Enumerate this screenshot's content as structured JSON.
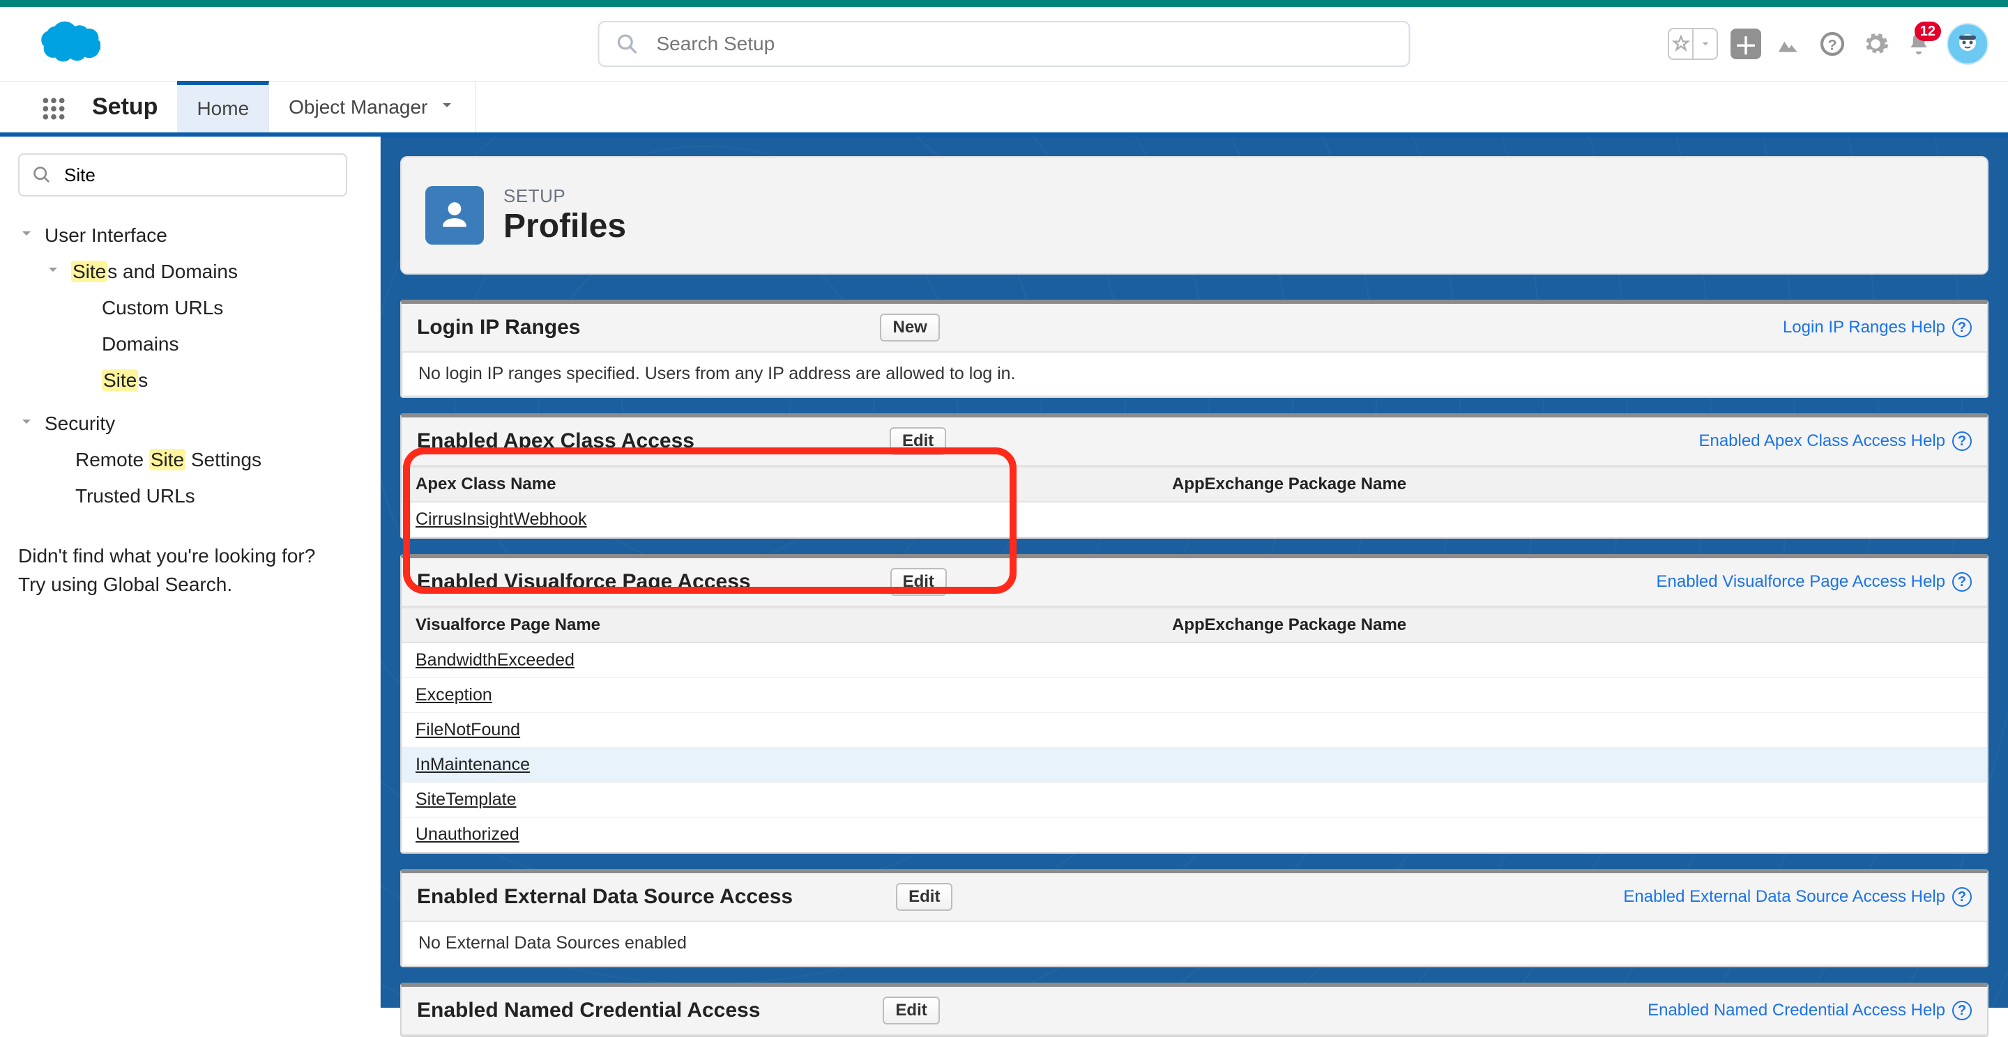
{
  "header": {
    "search_placeholder": "Search Setup",
    "notification_count": "12"
  },
  "context": {
    "app_name": "Setup",
    "tab_home": "Home",
    "tab_obj": "Object Manager"
  },
  "sidebar": {
    "quickfind_value": "Site",
    "node_ui": "User Interface",
    "node_sites_domains_pre": "Site",
    "node_sites_domains_post": "s and Domains",
    "leaf_custom_urls": "Custom URLs",
    "leaf_domains": "Domains",
    "leaf_sites_pre": "Site",
    "leaf_sites_post": "s",
    "node_security": "Security",
    "leaf_remote_pre1": "Remote ",
    "leaf_remote_hl": "Site",
    "leaf_remote_post": " Settings",
    "leaf_trusted": "Trusted URLs",
    "hint_line1": "Didn't find what you're looking for?",
    "hint_line2": "Try using Global Search."
  },
  "page": {
    "eyebrow": "SETUP",
    "title": "Profiles"
  },
  "sections": {
    "login_ip": {
      "title": "Login IP Ranges",
      "btn": "New",
      "help": "Login IP Ranges Help",
      "msg": "No login IP ranges specified. Users from any IP address are allowed to log in."
    },
    "apex": {
      "title": "Enabled Apex Class Access",
      "btn": "Edit",
      "help": "Enabled Apex Class Access Help",
      "col_a": "Apex Class Name",
      "col_b": "AppExchange Package Name",
      "rows": [
        "CirrusInsightWebhook"
      ]
    },
    "vf": {
      "title": "Enabled Visualforce Page Access",
      "btn": "Edit",
      "help": "Enabled Visualforce Page Access Help",
      "col_a": "Visualforce Page Name",
      "col_b": "AppExchange Package Name",
      "rows": [
        "BandwidthExceeded",
        "Exception",
        "FileNotFound",
        "InMaintenance",
        "SiteTemplate",
        "Unauthorized"
      ]
    },
    "ext": {
      "title": "Enabled External Data Source Access",
      "btn": "Edit",
      "help": "Enabled External Data Source Access Help",
      "msg": "No External Data Sources enabled"
    },
    "named": {
      "title": "Enabled Named Credential Access",
      "btn": "Edit",
      "help": "Enabled Named Credential Access Help"
    }
  }
}
